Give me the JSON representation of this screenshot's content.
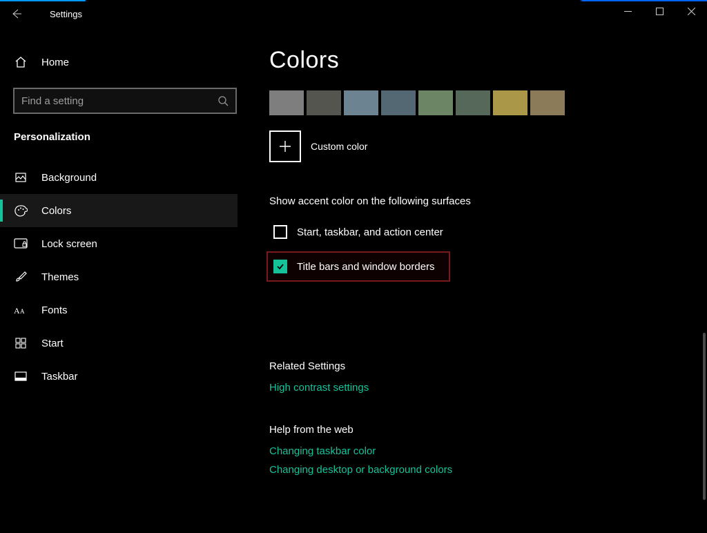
{
  "window": {
    "title": "Settings"
  },
  "sidebar": {
    "home": "Home",
    "search_placeholder": "Find a setting",
    "section": "Personalization",
    "items": [
      {
        "label": "Background",
        "icon": "picture-icon"
      },
      {
        "label": "Colors",
        "icon": "palette-icon",
        "active": true
      },
      {
        "label": "Lock screen",
        "icon": "lockscreen-icon"
      },
      {
        "label": "Themes",
        "icon": "brush-icon"
      },
      {
        "label": "Fonts",
        "icon": "fonts-icon"
      },
      {
        "label": "Start",
        "icon": "start-icon"
      },
      {
        "label": "Taskbar",
        "icon": "taskbar-icon"
      }
    ]
  },
  "main": {
    "title": "Colors",
    "swatches": [
      "#7e7e7e",
      "#555550",
      "#6c8492",
      "#546874",
      "#6c8564",
      "#556859",
      "#aa9747",
      "#8c7b59"
    ],
    "custom_color_label": "Custom color",
    "accent_surfaces_label": "Show accent color on the following surfaces",
    "checkboxes": [
      {
        "label": "Start, taskbar, and action center",
        "checked": false
      },
      {
        "label": "Title bars and window borders",
        "checked": true,
        "highlighted": true
      }
    ],
    "related": {
      "heading": "Related Settings",
      "links": [
        "High contrast settings"
      ]
    },
    "help": {
      "heading": "Help from the web",
      "links": [
        "Changing taskbar color",
        "Changing desktop or background colors"
      ]
    }
  },
  "accent_color": "#15c29a"
}
